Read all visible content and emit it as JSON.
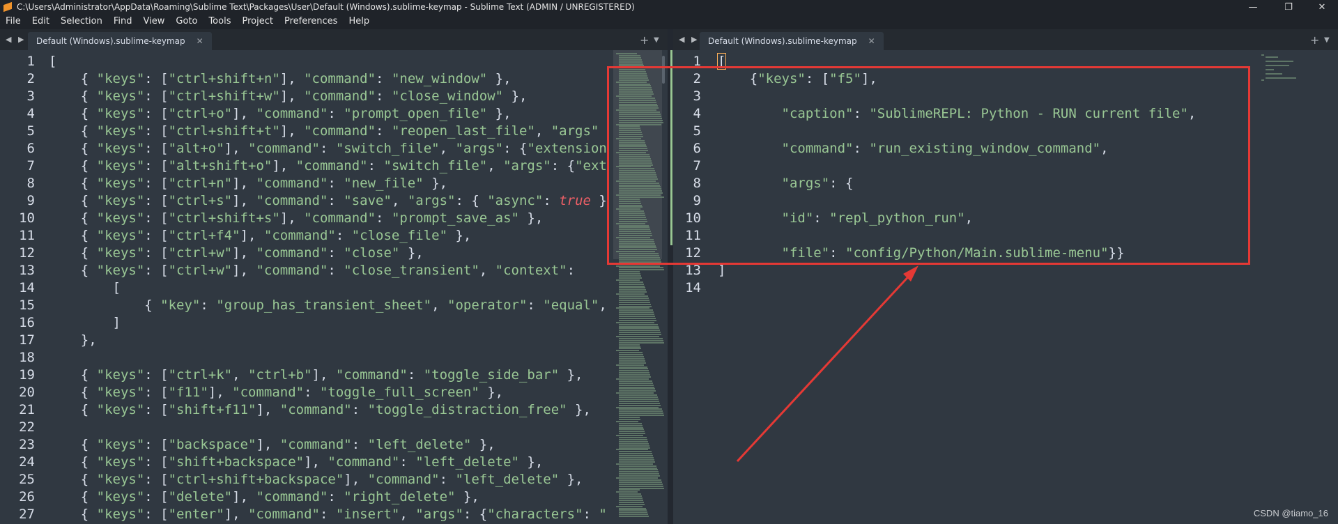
{
  "window": {
    "title": "C:\\Users\\Administrator\\AppData\\Roaming\\Sublime Text\\Packages\\User\\Default (Windows).sublime-keymap - Sublime Text (ADMIN / UNREGISTERED)",
    "minimize": "—",
    "maximize": "❐",
    "close": "✕"
  },
  "menu": [
    "File",
    "Edit",
    "Selection",
    "Find",
    "View",
    "Goto",
    "Tools",
    "Project",
    "Preferences",
    "Help"
  ],
  "left_pane": {
    "nav": "◀ ▶",
    "tab_label": "Default (Windows).sublime-keymap",
    "tab_close": "✕",
    "plus": "+",
    "menu_arrow": "▼",
    "lines": [
      {
        "n": "1",
        "t": "["
      },
      {
        "n": "2",
        "t": "    { \"keys\": [\"ctrl+shift+n\"], \"command\": \"new_window\" },"
      },
      {
        "n": "3",
        "t": "    { \"keys\": [\"ctrl+shift+w\"], \"command\": \"close_window\" },"
      },
      {
        "n": "4",
        "t": "    { \"keys\": [\"ctrl+o\"], \"command\": \"prompt_open_file\" },"
      },
      {
        "n": "5",
        "t": "    { \"keys\": [\"ctrl+shift+t\"], \"command\": \"reopen_last_file\", \"args\""
      },
      {
        "n": "6",
        "t": "    { \"keys\": [\"alt+o\"], \"command\": \"switch_file\", \"args\": {\"extension"
      },
      {
        "n": "7",
        "t": "    { \"keys\": [\"alt+shift+o\"], \"command\": \"switch_file\", \"args\": {\"ext"
      },
      {
        "n": "8",
        "t": "    { \"keys\": [\"ctrl+n\"], \"command\": \"new_file\" },"
      },
      {
        "n": "9",
        "t": "    { \"keys\": [\"ctrl+s\"], \"command\": \"save\", \"args\": { \"async\": true }"
      },
      {
        "n": "10",
        "t": "    { \"keys\": [\"ctrl+shift+s\"], \"command\": \"prompt_save_as\" },"
      },
      {
        "n": "11",
        "t": "    { \"keys\": [\"ctrl+f4\"], \"command\": \"close_file\" },"
      },
      {
        "n": "12",
        "t": "    { \"keys\": [\"ctrl+w\"], \"command\": \"close\" },"
      },
      {
        "n": "13",
        "t": "    { \"keys\": [\"ctrl+w\"], \"command\": \"close_transient\", \"context\":"
      },
      {
        "n": "14",
        "t": "        ["
      },
      {
        "n": "15",
        "t": "            { \"key\": \"group_has_transient_sheet\", \"operator\": \"equal\","
      },
      {
        "n": "16",
        "t": "        ]"
      },
      {
        "n": "17",
        "t": "    },"
      },
      {
        "n": "18",
        "t": ""
      },
      {
        "n": "19",
        "t": "    { \"keys\": [\"ctrl+k\", \"ctrl+b\"], \"command\": \"toggle_side_bar\" },"
      },
      {
        "n": "20",
        "t": "    { \"keys\": [\"f11\"], \"command\": \"toggle_full_screen\" },"
      },
      {
        "n": "21",
        "t": "    { \"keys\": [\"shift+f11\"], \"command\": \"toggle_distraction_free\" },"
      },
      {
        "n": "22",
        "t": ""
      },
      {
        "n": "23",
        "t": "    { \"keys\": [\"backspace\"], \"command\": \"left_delete\" },"
      },
      {
        "n": "24",
        "t": "    { \"keys\": [\"shift+backspace\"], \"command\": \"left_delete\" },"
      },
      {
        "n": "25",
        "t": "    { \"keys\": [\"ctrl+shift+backspace\"], \"command\": \"left_delete\" },"
      },
      {
        "n": "26",
        "t": "    { \"keys\": [\"delete\"], \"command\": \"right_delete\" },"
      },
      {
        "n": "27",
        "t": "    { \"keys\": [\"enter\"], \"command\": \"insert\", \"args\": {\"characters\": \""
      }
    ]
  },
  "right_pane": {
    "nav": "◀ ▶",
    "tab_label": "Default (Windows).sublime-keymap",
    "tab_close": "✕",
    "plus": "+",
    "menu_arrow": "▼",
    "lines": [
      {
        "n": "1",
        "t": "["
      },
      {
        "n": "2",
        "t": "    {\"keys\": [\"f5\"],"
      },
      {
        "n": "3",
        "t": ""
      },
      {
        "n": "4",
        "t": "        \"caption\": \"SublimeREPL: Python - RUN current file\","
      },
      {
        "n": "5",
        "t": ""
      },
      {
        "n": "6",
        "t": "        \"command\": \"run_existing_window_command\","
      },
      {
        "n": "7",
        "t": ""
      },
      {
        "n": "8",
        "t": "        \"args\": {"
      },
      {
        "n": "9",
        "t": ""
      },
      {
        "n": "10",
        "t": "        \"id\": \"repl_python_run\","
      },
      {
        "n": "11",
        "t": ""
      },
      {
        "n": "12",
        "t": "        \"file\": \"config/Python/Main.sublime-menu\"}}"
      },
      {
        "n": "13",
        "t": "]"
      },
      {
        "n": "14",
        "t": ""
      }
    ]
  },
  "watermark": "CSDN @tiamo_16",
  "colors": {
    "background": "#303841",
    "string": "#99c794",
    "keyword": "#ec5f66",
    "annotation": "#e53935"
  }
}
